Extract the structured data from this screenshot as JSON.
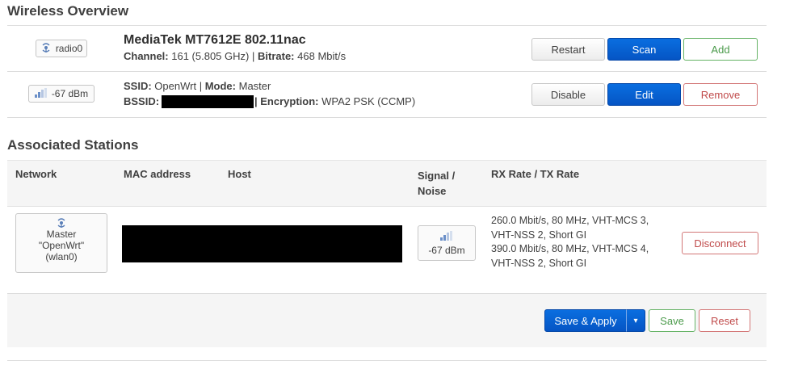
{
  "wireless_overview": {
    "title": "Wireless Overview",
    "device": {
      "badge": "radio0",
      "name": "MediaTek MT7612E 802.11nac",
      "channel_label": "Channel:",
      "channel_value": "161 (5.805 GHz)",
      "sep": "|",
      "bitrate_label": "Bitrate:",
      "bitrate_value": "468 Mbit/s",
      "buttons": {
        "restart": "Restart",
        "scan": "Scan",
        "add": "Add"
      }
    },
    "network": {
      "badge": "-67 dBm",
      "ssid_label": "SSID:",
      "ssid_value": "OpenWrt",
      "sep": "|",
      "mode_label": "Mode:",
      "mode_value": "Master",
      "bssid_label": "BSSID:",
      "encryption_label": "| Encryption:",
      "encryption_value": "WPA2 PSK (CCMP)",
      "buttons": {
        "disable": "Disable",
        "edit": "Edit",
        "remove": "Remove"
      }
    }
  },
  "associated_stations": {
    "title": "Associated Stations",
    "headers": {
      "network": "Network",
      "mac": "MAC address",
      "host": "Host",
      "signal_line1": "Signal /",
      "signal_line2": "Noise",
      "rates": "RX Rate / TX Rate"
    },
    "rows": [
      {
        "network_line1": "Master",
        "network_line2": "\"OpenWrt\"",
        "network_line3": "(wlan0)",
        "signal": "-67 dBm",
        "rx_line1": "260.0 Mbit/s, 80 MHz, VHT-MCS 3,",
        "rx_line2": "VHT-NSS 2, Short GI",
        "tx_line1": "390.0 Mbit/s, 80 MHz, VHT-MCS 4,",
        "tx_line2": "VHT-NSS 2, Short GI",
        "disconnect": "Disconnect"
      }
    ]
  },
  "footer": {
    "save_apply": "Save & Apply",
    "dropdown": "▾",
    "save": "Save",
    "reset": "Reset"
  }
}
